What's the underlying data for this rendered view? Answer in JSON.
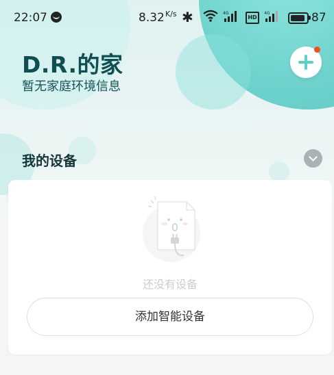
{
  "status_bar": {
    "time": "22:07",
    "speed": "8.32",
    "speed_unit": "K/s",
    "battery": "87",
    "icons": [
      "app-icon",
      "bluetooth-icon",
      "wifi-icon",
      "4g-signal-icon",
      "hd-icon",
      "4g-signal-icon",
      "battery-icon"
    ]
  },
  "header": {
    "title": "D.R.的家",
    "subtitle": "暂无家庭环境信息"
  },
  "devices": {
    "section_title": "我的设备",
    "empty_text": "还没有设备",
    "add_button_label": "添加智能设备"
  },
  "colors": {
    "accent": "#5ccfc6",
    "title": "#0f4f52",
    "notification_dot": "#f4511e"
  }
}
